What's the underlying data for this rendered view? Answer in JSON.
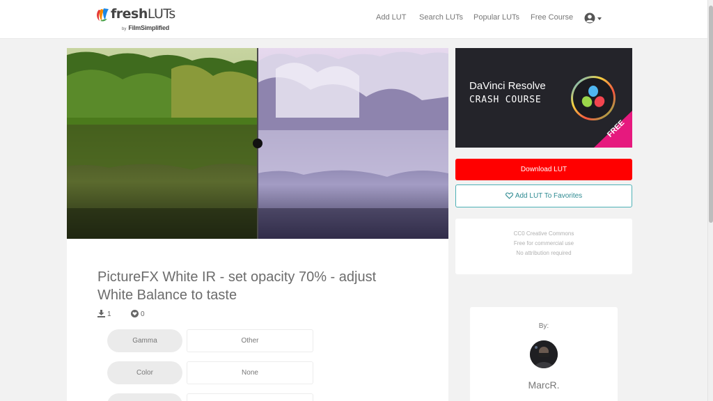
{
  "header": {
    "logo": {
      "fresh": "fresh",
      "luts": "LUTs",
      "by": "by",
      "brand": "FilmSimplified"
    },
    "nav": [
      {
        "label": "Add LUT"
      },
      {
        "label": "Search LUTs"
      },
      {
        "label": "Popular LUTs"
      },
      {
        "label": "Free Course"
      }
    ],
    "user_icon": "user-circle-icon"
  },
  "lut": {
    "title": "PictureFX White IR - set opacity 70% - adjust White Balance to taste",
    "downloads": "1",
    "favorites": "0",
    "properties": [
      {
        "label": "Gamma",
        "value": "Other"
      },
      {
        "label": "Color",
        "value": "None"
      }
    ]
  },
  "sidebar": {
    "ad": {
      "title": "DaVinci Resolve",
      "subtitle": "CRASH COURSE",
      "badge": "FREE"
    },
    "download_label": "Download LUT",
    "favorite_label": "Add LUT To Favorites",
    "license": {
      "line1": "CC0 Creative Commons",
      "line2": "Free for commercial use",
      "line3": "No attribution required"
    },
    "author": {
      "by_label": "By:",
      "name": "MarcR."
    }
  },
  "colors": {
    "download_button": "#ff0000",
    "favorite_border": "#4cb0b5",
    "favorite_text": "#2d8a91",
    "ad_background": "#24242a",
    "ribbon": "#e6197e"
  }
}
